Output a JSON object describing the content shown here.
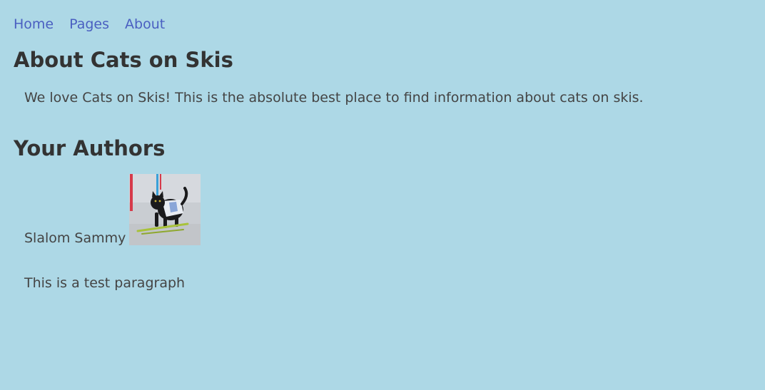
{
  "nav": {
    "items": [
      {
        "label": "Home"
      },
      {
        "label": "Pages"
      },
      {
        "label": "About"
      }
    ]
  },
  "page": {
    "title": "About Cats on Skis",
    "intro": "We love Cats on Skis! This is the absolute best place to find information about cats on skis."
  },
  "authors": {
    "heading": "Your Authors",
    "list": [
      {
        "name": "Slalom Sammy",
        "photo_icon": "cat-skiing-photo"
      }
    ]
  },
  "test_paragraph": "This is a test paragraph",
  "colors": {
    "background": "#add8e6",
    "link": "#4a5fc1",
    "heading": "#333333",
    "text": "#444444"
  }
}
